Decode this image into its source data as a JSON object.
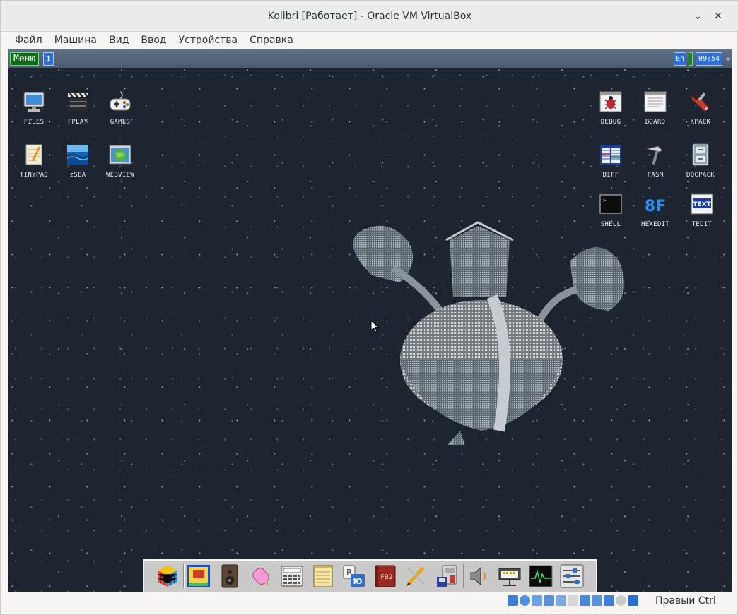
{
  "window": {
    "title": "Kolibri [Работает] - Oracle VM VirtualBox",
    "minimize": "⌄",
    "close": "✕"
  },
  "menubar": [
    "Файл",
    "Машина",
    "Вид",
    "Ввод",
    "Устройства",
    "Справка"
  ],
  "kolibri_panel": {
    "menu_button": "Меню",
    "switch_icon": "↕",
    "language": "En",
    "clock": "09:54"
  },
  "desktop_icons_left": [
    {
      "label": "FILES",
      "icon": "monitor-icon"
    },
    {
      "label": "FPLAY",
      "icon": "clapperboard-icon"
    },
    {
      "label": "GAMES",
      "icon": "gamepad-icon"
    },
    {
      "label": "TINYPAD",
      "icon": "notepad-icon"
    },
    {
      "label": "zSEA",
      "icon": "sea-picture-icon"
    },
    {
      "label": "WEBVIEW",
      "icon": "globe-window-icon"
    }
  ],
  "desktop_icons_right": [
    {
      "label": "DEBUG",
      "icon": "bug-window-icon"
    },
    {
      "label": "BOARD",
      "icon": "board-window-icon"
    },
    {
      "label": "KPACK",
      "icon": "wrench-icon"
    },
    {
      "label": "DIFF",
      "icon": "diff-table-icon"
    },
    {
      "label": "FASM",
      "icon": "hammer-icon"
    },
    {
      "label": "DOCPACK",
      "icon": "cabinet-icon"
    },
    {
      "label": "SHELL",
      "icon": "terminal-icon"
    },
    {
      "label": "HEXEDIT",
      "icon": "hex-8f-icon"
    },
    {
      "label": "TEDIT",
      "icon": "text-editor-icon"
    }
  ],
  "hexedit_glyph": "8F",
  "tedit_glyph": "TEXT",
  "shell_glyph": ">_",
  "dock": {
    "items": [
      "cube-icon",
      "pixel-editor-icon",
      "speaker-icon",
      "eraser-icon",
      "calculator-icon",
      "notepad-icon",
      "translator-icon",
      "fb2-reader-icon",
      "pencil-icon",
      "archiver-icon",
      "volume-icon",
      "network-icon",
      "system-monitor-icon",
      "settings-sliders-icon"
    ],
    "fb2_label": "FB2",
    "translator_label": "Ю"
  },
  "statusbar": {
    "host_key": "Правый Ctrl"
  }
}
